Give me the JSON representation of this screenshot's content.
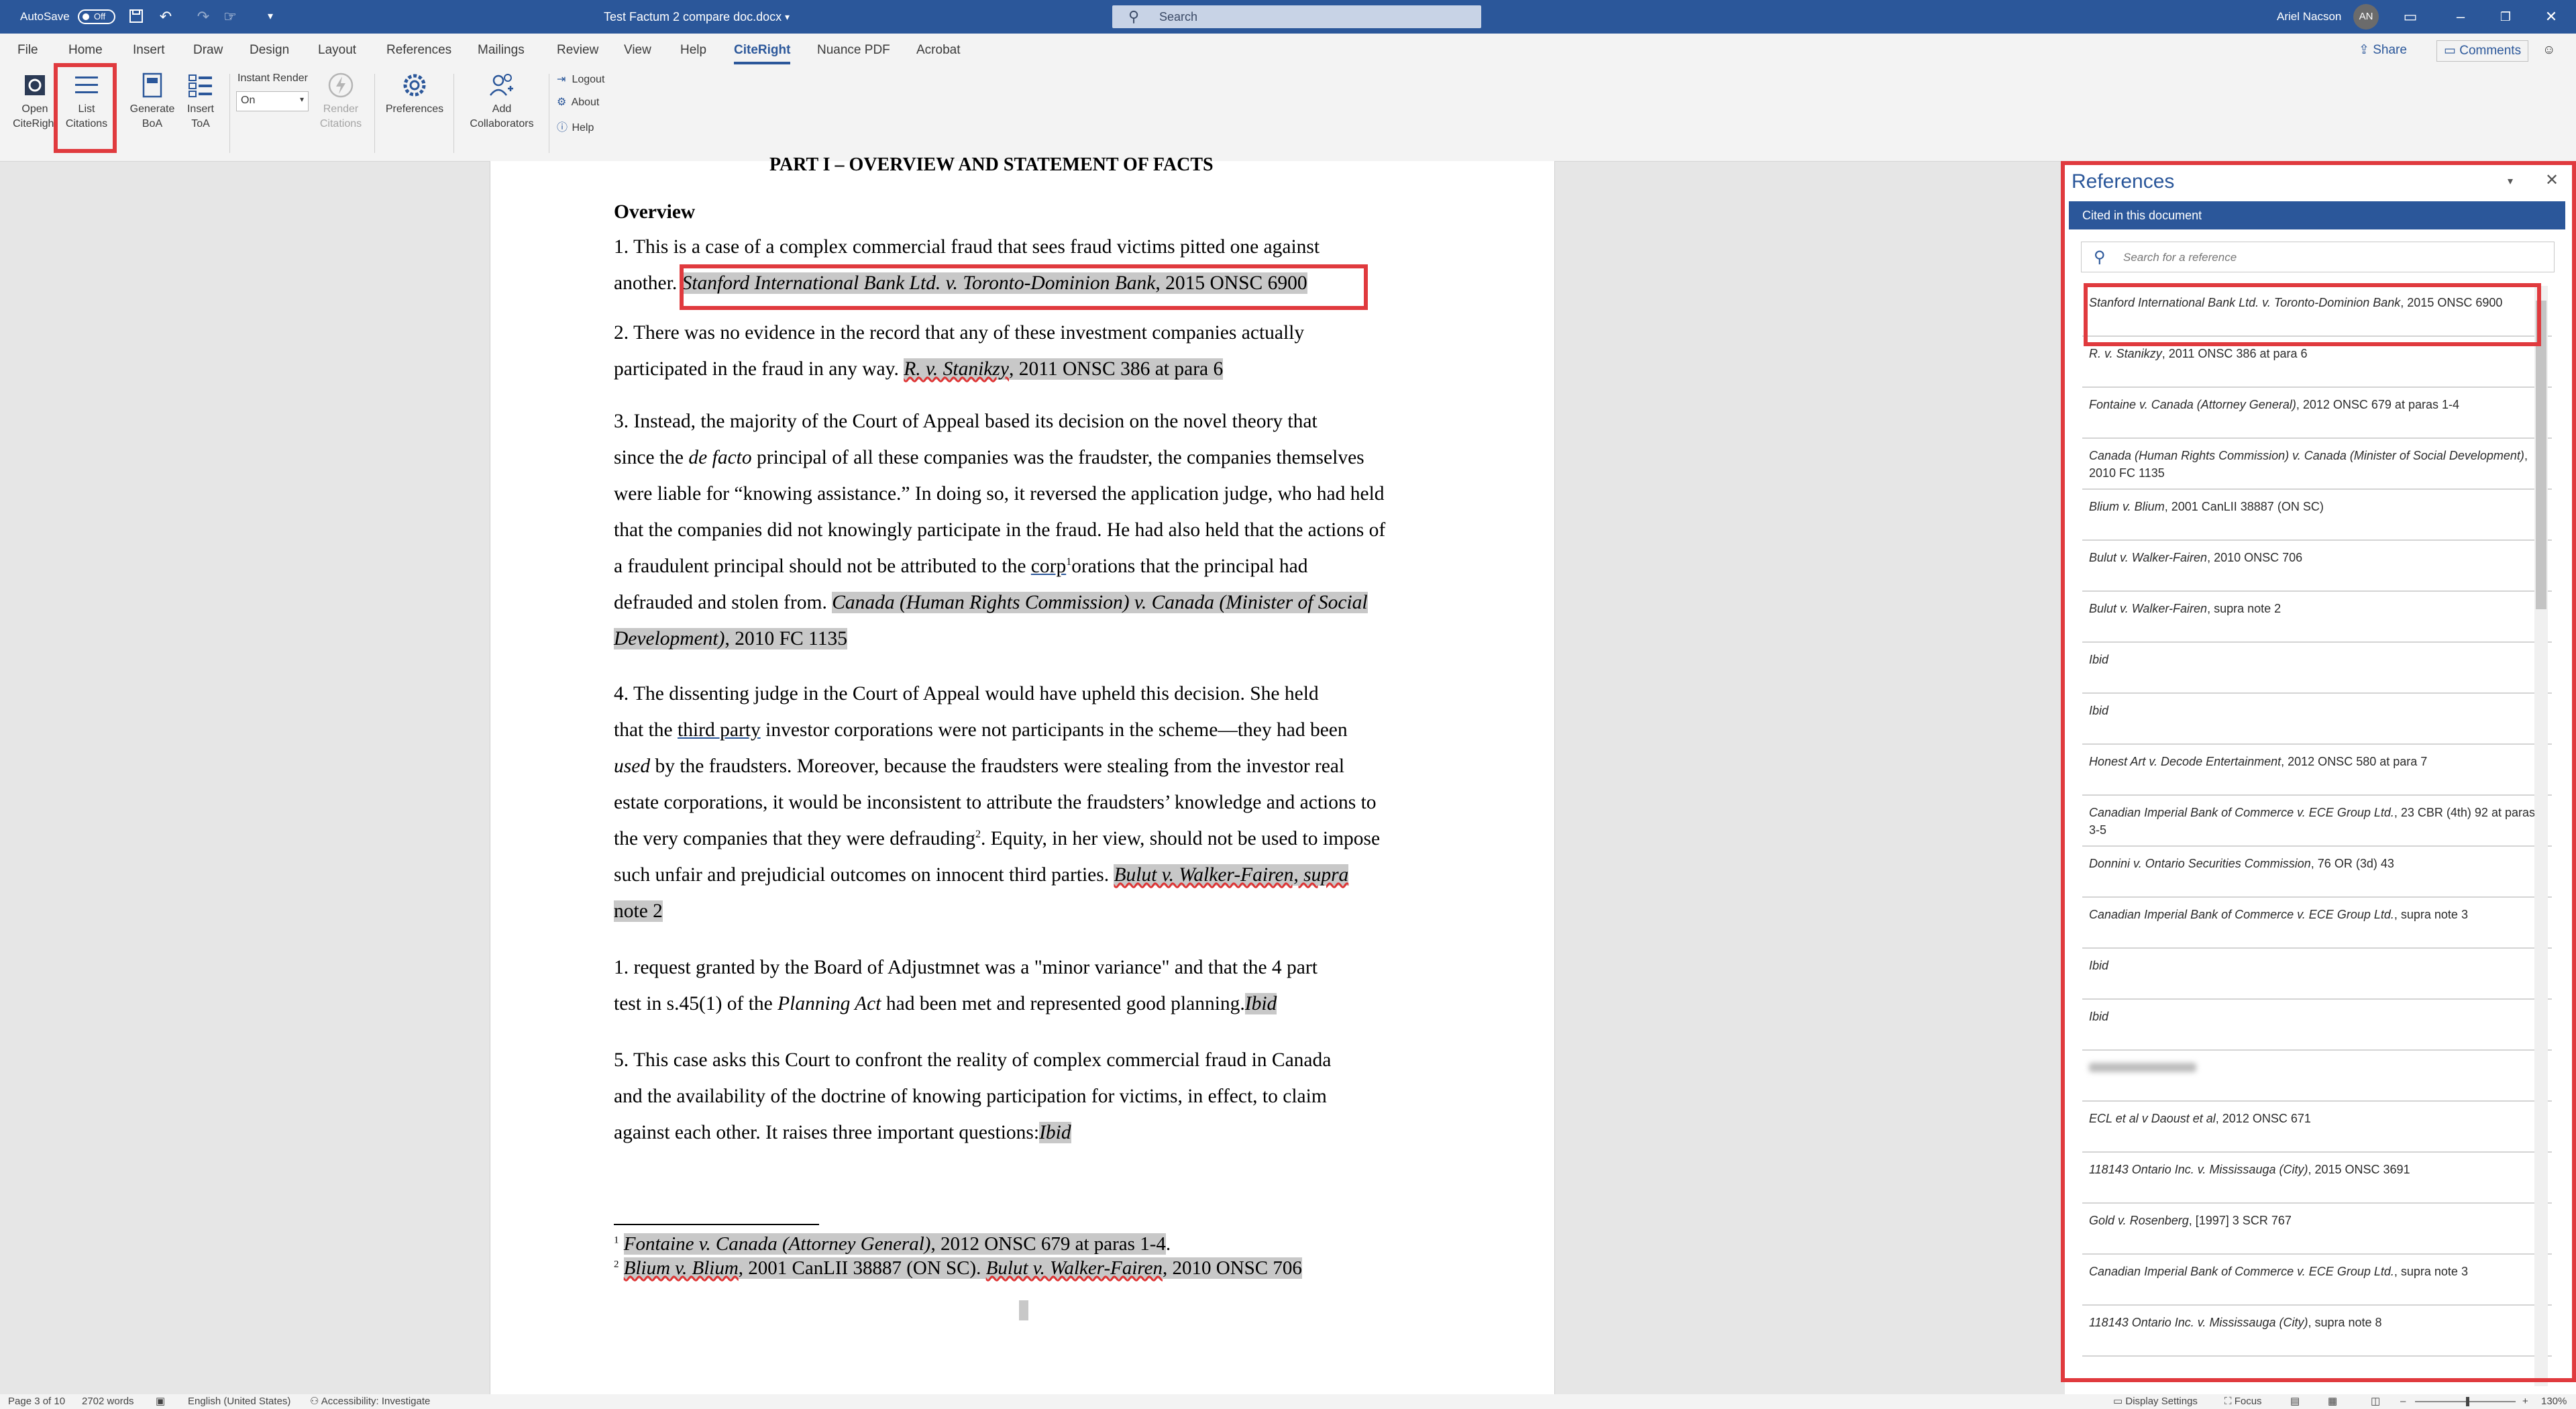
{
  "titlebar": {
    "autosave_label": "AutoSave",
    "autosave_state": "Off",
    "document_title": "Test Factum 2 compare doc.docx",
    "search_placeholder": "Search",
    "user_name": "Ariel Nacson",
    "user_initials": "AN"
  },
  "menu_tabs": [
    "File",
    "Home",
    "Insert",
    "Draw",
    "Design",
    "Layout",
    "References",
    "Mailings",
    "Review",
    "View",
    "Help",
    "CiteRight",
    "Nuance PDF",
    "Acrobat"
  ],
  "active_tab": "CiteRight",
  "share_label": "Share",
  "comments_label": "Comments",
  "ribbon": {
    "open_citeright": [
      "Open",
      "CiteRight"
    ],
    "list_citations": [
      "List",
      "Citations"
    ],
    "generate_boa": [
      "Generate",
      "BoA"
    ],
    "insert_toa": [
      "Insert",
      "ToA"
    ],
    "instant_render_label": "Instant Render",
    "instant_render_value": "On",
    "render_citations": [
      "Render",
      "Citations"
    ],
    "preferences": "Preferences",
    "add_collaborators": [
      "Add",
      "Collaborators"
    ],
    "logout": "Logout",
    "about": "About",
    "help": "Help"
  },
  "document": {
    "heading": "PART I – OVERVIEW AND STATEMENT OF FACTS",
    "overview": "Overview",
    "p1_line1": "1.          This is a case of a complex commercial fraud that sees fraud victims pitted one against",
    "p1_line2_a": "another.",
    "p1_cite_italic": "Stanford International Bank Ltd. v. Toronto-Dominion Bank",
    "p1_cite_rest": ", 2015 ONSC 6900",
    "p2_line1": "2.          There was no evidence in the record that any of these investment companies actually",
    "p2_line2_a": "participated in the fraud in any way. ",
    "p2_cite_italic": "R. v. Stanikzy",
    "p2_cite_rest": ", 2011 ONSC 386 at para 6",
    "p3_line1": "3.          Instead, the majority of the Court of Appeal based its decision on the novel theory that",
    "p3_line2_a": "since the ",
    "p3_line2_i": "de facto",
    "p3_line2_b": " principal of all these companies was the fraudster, the companies themselves",
    "p3_line3": "were liable for “knowing assistance.” In doing so, it reversed the application judge, who had held",
    "p3_line4": "that the companies did not knowingly participate in the fraud. He had also held that the actions of",
    "p3_line5_a": "a fraudulent principal should not be attributed to the ",
    "p3_line5_corp": "corp",
    "p3_line5_sup": "1",
    "p3_line5_b": "orations that the principal had",
    "p3_line6_a": "defrauded and stolen from. ",
    "p3_cite_italic_1": "Canada (Human Rights Commission) v. Canada (Minister of Social",
    "p3_cite_italic_2": "Development)",
    "p3_cite_rest": ", 2010 FC 1135",
    "p4_line1": "4.          The dissenting judge in the Court of Appeal would have upheld this decision. She held",
    "p4_line2_a": "that the ",
    "p4_line2_tp": "third party",
    "p4_line2_b": " investor corporations were not participants in the scheme—they had been",
    "p4_line3_i": "used",
    "p4_line3_b": " by the fraudsters. Moreover, because the fraudsters were stealing from the investor real",
    "p4_line4": "estate corporations, it would be inconsistent to attribute the fraudsters’ knowledge and actions to",
    "p4_line5_a": "the very companies that they were defrauding",
    "p4_line5_sup": "2",
    "p4_line5_b": ". Equity, in her view, should not be used to impose",
    "p4_line6_a": "such unfair and prejudicial outcomes on innocent third parties. ",
    "p4_cite_italic": "Bulut v. Walker-Fairen, supra",
    "p4_cite_line2": "note 2",
    "p5_line1": "1.          request granted by the Board of Adjustmnet was a \"minor variance\" and that the 4 part",
    "p5_line2_a": "test in s.45(1) of the ",
    "p5_line2_i": "Planning Act",
    "p5_line2_b": " had been met and represented good planning.",
    "p5_ibid": "Ibid",
    "p6_line1": "5.          This case asks this Court to confront the reality of complex commercial fraud in Canada",
    "p6_line2": "and the availability of the doctrine of knowing participation for victims, in effect, to claim",
    "p6_line3_a": "against each other. It raises three important questions:",
    "p6_ibid": "Ibid",
    "fn1_num": "1",
    "fn1_italic": "Fontaine v. Canada (Attorney General)",
    "fn1_rest": ", 2012 ONSC 679 at paras 1-4",
    "fn1_end": ".",
    "fn2_num": "2",
    "fn2_italic_1": "Blium v. Blium",
    "fn2_rest_1": ", 2001 CanLII 38887 (ON SC). ",
    "fn2_italic_2": "Bulut v. Walker-Fairen",
    "fn2_rest_2": ", 2010 ONSC 706"
  },
  "references": {
    "title": "References",
    "cited_label": "Cited in this document",
    "search_placeholder": "Search for a reference",
    "items": [
      {
        "italic": "Stanford International Bank Ltd. v. Toronto-Dominion Bank",
        "rest": ", 2015 ONSC 6900"
      },
      {
        "italic": "R. v. Stanikzy",
        "rest": ", 2011 ONSC 386 at para 6"
      },
      {
        "italic": "Fontaine v. Canada (Attorney General)",
        "rest": ", 2012 ONSC 679 at paras 1-4"
      },
      {
        "italic": "Canada (Human Rights Commission) v. Canada (Minister of Social Development)",
        "rest": ", 2010 FC 1135"
      },
      {
        "italic": "Blium v. Blium",
        "rest": ", 2001 CanLII 38887 (ON SC)"
      },
      {
        "italic": "Bulut v. Walker-Fairen",
        "rest": ", 2010 ONSC 706"
      },
      {
        "italic": "Bulut v. Walker-Fairen",
        "rest": ", supra note 2"
      },
      {
        "italic": "Ibid",
        "rest": ""
      },
      {
        "italic": "Ibid",
        "rest": ""
      },
      {
        "italic": "Honest Art v. Decode Entertainment",
        "rest": ", 2012 ONSC 580 at para 7"
      },
      {
        "italic": "Canadian Imperial Bank of Commerce v. ECE Group Ltd.",
        "rest": ", 23 CBR (4th) 92 at paras 3-5"
      },
      {
        "italic": "Donnini v. Ontario Securities Commission",
        "rest": ", 76 OR (3d) 43"
      },
      {
        "italic": "Canadian Imperial Bank of Commerce v. ECE Group Ltd.",
        "rest": ", supra note 3"
      },
      {
        "italic": "Ibid",
        "rest": ""
      },
      {
        "italic": "Ibid",
        "rest": ""
      },
      {
        "italic": "",
        "rest": "",
        "blurred": true
      },
      {
        "italic": "ECL et al v Daoust et al",
        "rest": ", 2012 ONSC 671"
      },
      {
        "italic": "118143 Ontario Inc. v. Mississauga (City)",
        "rest": ", 2015 ONSC 3691"
      },
      {
        "italic": "Gold v. Rosenberg",
        "rest": ", [1997] 3 SCR 767"
      },
      {
        "italic": "Canadian Imperial Bank of Commerce v. ECE Group Ltd.",
        "rest": ", supra note 3"
      },
      {
        "italic": "118143 Ontario Inc. v. Mississauga (City)",
        "rest": ", supra note 8"
      }
    ]
  },
  "statusbar": {
    "page": "Page 3 of 10",
    "words": "2702 words",
    "language": "English (United States)",
    "accessibility": "Accessibility: Investigate",
    "display_settings": "Display Settings",
    "focus": "Focus",
    "zoom": "130%"
  },
  "colors": {
    "accent": "#2b579a",
    "highlight_box": "#e03a3e",
    "citation_highlight": "#c8c8c8"
  }
}
